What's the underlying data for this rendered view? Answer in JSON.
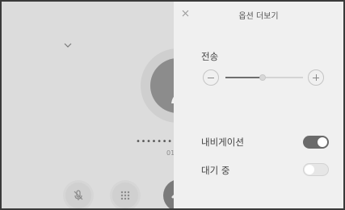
{
  "call_screen": {
    "phone_number": "••••••••••",
    "duration": "01",
    "icons": [
      "chevron-down-icon",
      "person-icon",
      "mic-muted-icon",
      "keypad-icon",
      "end-call-icon"
    ]
  },
  "options_panel": {
    "title": "옵션 더보기",
    "close_icon": "close-icon",
    "volume": {
      "label": "전송",
      "level": 0.48
    },
    "navigation": {
      "label": "내비게이션",
      "enabled": true
    },
    "standby": {
      "label": "대기 중",
      "enabled": false
    }
  },
  "colors": {
    "toggle_on": "#6a6a6a",
    "toggle_off": "#e6e6e6",
    "panel_bg": "#f0f0f0"
  }
}
